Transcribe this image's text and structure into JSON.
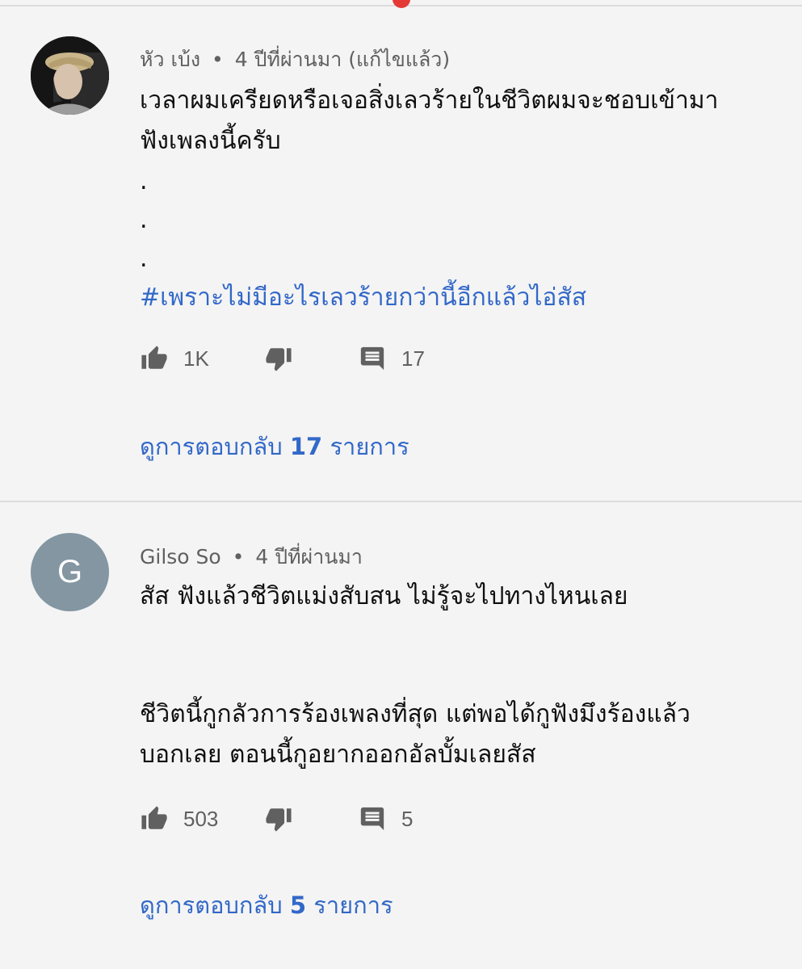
{
  "comments": [
    {
      "author": "หัว เบ้ง",
      "time": "4 ปีที่ผ่านมา (แก้ไขแล้ว)",
      "lines": [
        "เวลาผมเครียดหรือเจอสิ่งเลวร้ายในชีวิตผมจะชอบเข้ามา",
        "ฟังเพลงนี้ครับ",
        ".",
        ".",
        "."
      ],
      "hashtag": "#เพราะไม่มีอะไรเลวร้ายกว่านี้อีกแล้วไอ่สัส",
      "likes": "1K",
      "reply_count": "17",
      "view_replies_prefix": "ดูการตอบกลับ",
      "view_replies_count": "17",
      "view_replies_suffix": "รายการ"
    },
    {
      "author": "Gilso So",
      "avatar_letter": "G",
      "time": "4 ปีที่ผ่านมา",
      "lines": [
        "สัส ฟังแล้วชีวิตแม่งสับสน ไม่รู้จะไปทางไหนเลย",
        "",
        "",
        "ชีวิตนี้กูกลัวการร้องเพลงที่สุด แต่พอได้กูฟังมึงร้องแล้ว",
        "บอกเลย ตอนนี้กูอยากออกอัลบั้มเลยสัส"
      ],
      "likes": "503",
      "reply_count": "5",
      "view_replies_prefix": "ดูการตอบกลับ",
      "view_replies_count": "5",
      "view_replies_suffix": "รายการ"
    }
  ],
  "meta_separator": "•",
  "colors": {
    "link": "#3268c8",
    "secondary_text": "#606060",
    "background": "#f4f4f4",
    "notification": "#e53935"
  },
  "icons": [
    "thumb-up-icon",
    "thumb-down-icon",
    "comment-icon"
  ]
}
